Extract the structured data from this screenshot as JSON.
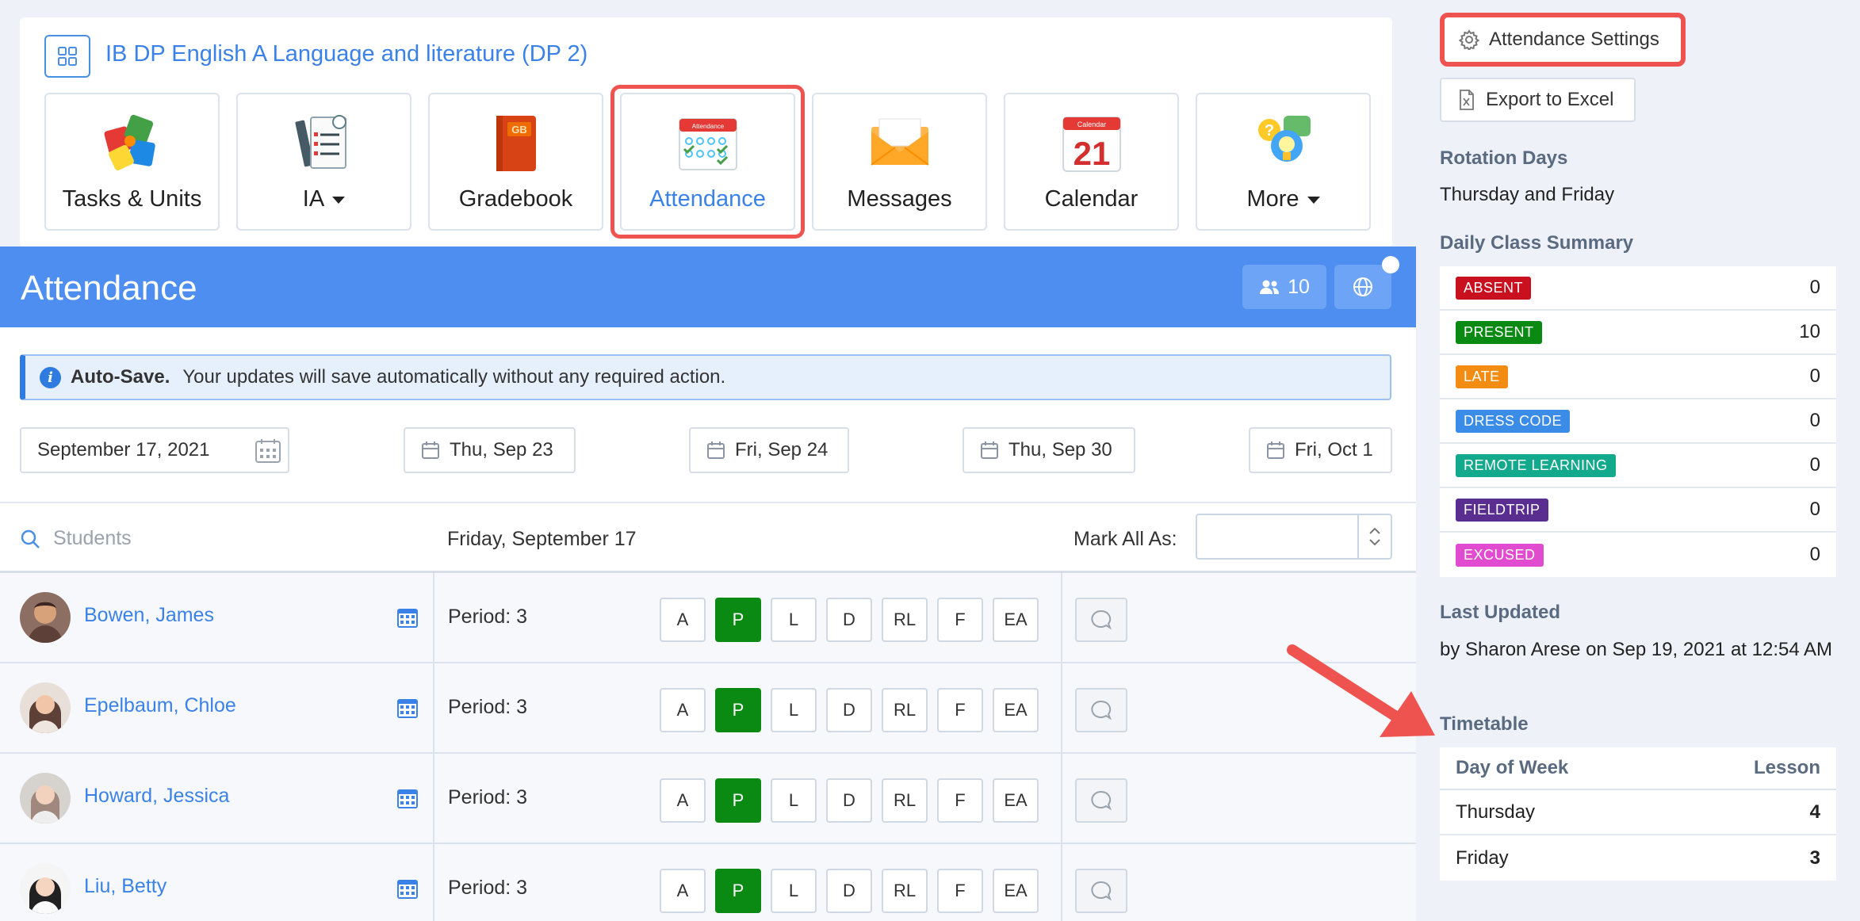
{
  "course": {
    "title": "IB DP English A Language and literature (DP 2)"
  },
  "tiles": [
    {
      "label": "Tasks & Units",
      "icon": "puzzle-icon",
      "dropdown": false,
      "active": false
    },
    {
      "label": "IA",
      "icon": "checklist-icon",
      "dropdown": true,
      "active": false
    },
    {
      "label": "Gradebook",
      "icon": "gradebook-icon",
      "dropdown": false,
      "active": false
    },
    {
      "label": "Attendance",
      "icon": "attendance-icon",
      "dropdown": false,
      "active": true
    },
    {
      "label": "Messages",
      "icon": "envelope-icon",
      "dropdown": false,
      "active": false
    },
    {
      "label": "Calendar",
      "icon": "calendar-21-icon",
      "dropdown": false,
      "active": false
    },
    {
      "label": "More",
      "icon": "help-bubbles-icon",
      "dropdown": true,
      "active": false
    }
  ],
  "tile_icon_text": {
    "gradebook": "GB",
    "attendance": "Attendance",
    "calendar_header": "Calendar",
    "calendar_day": "21"
  },
  "attendance": {
    "title": "Attendance",
    "student_count": "10",
    "autosave_title": "Auto-Save.",
    "autosave_text": "Your updates will save automatically without any required action.",
    "date_value": "September 17, 2021",
    "date_buttons": [
      "Thu, Sep 23",
      "Fri, Sep 24",
      "Thu, Sep 30",
      "Fri, Oct 1"
    ],
    "search_placeholder": "Students",
    "current_date": "Friday, September 17",
    "mark_all_label": "Mark All As:",
    "mark_all_value": ""
  },
  "status_codes": [
    "A",
    "P",
    "L",
    "D",
    "RL",
    "F",
    "EA"
  ],
  "students": [
    {
      "name": "Bowen, James",
      "period": "Period: 3",
      "selected": "P"
    },
    {
      "name": "Epelbaum, Chloe",
      "period": "Period: 3",
      "selected": "P"
    },
    {
      "name": "Howard, Jessica",
      "period": "Period: 3",
      "selected": "P"
    },
    {
      "name": "Liu, Betty",
      "period": "Period: 3",
      "selected": "P"
    }
  ],
  "sidebar": {
    "settings_label": "Attendance Settings",
    "export_label": "Export to Excel",
    "rotation_heading": "Rotation Days",
    "rotation_text": "Thursday and Friday",
    "summary_heading": "Daily Class Summary",
    "summary": [
      {
        "label": "ABSENT",
        "value": "0",
        "color": "#c8101e"
      },
      {
        "label": "PRESENT",
        "value": "10",
        "color": "#0a8a12"
      },
      {
        "label": "LATE",
        "value": "0",
        "color": "#f28c13"
      },
      {
        "label": "DRESS CODE",
        "value": "0",
        "color": "#3b8ce6"
      },
      {
        "label": "REMOTE LEARNING",
        "value": "0",
        "color": "#13a98c"
      },
      {
        "label": "FIELDTRIP",
        "value": "0",
        "color": "#5a2d91"
      },
      {
        "label": "EXCUSED",
        "value": "0",
        "color": "#e04bd0"
      }
    ],
    "last_updated_heading": "Last Updated",
    "last_updated_text": "by Sharon Arese on Sep 19, 2021 at 12:54 AM",
    "timetable_heading": "Timetable",
    "timetable_columns": [
      "Day of Week",
      "Lesson"
    ],
    "timetable_rows": [
      {
        "day": "Thursday",
        "lesson": "4"
      },
      {
        "day": "Friday",
        "lesson": "3"
      }
    ]
  },
  "colors": {
    "accent": "#3b82e8",
    "banner": "#4d8ef0",
    "highlight": "#ef5350",
    "present": "#0a8a12"
  }
}
